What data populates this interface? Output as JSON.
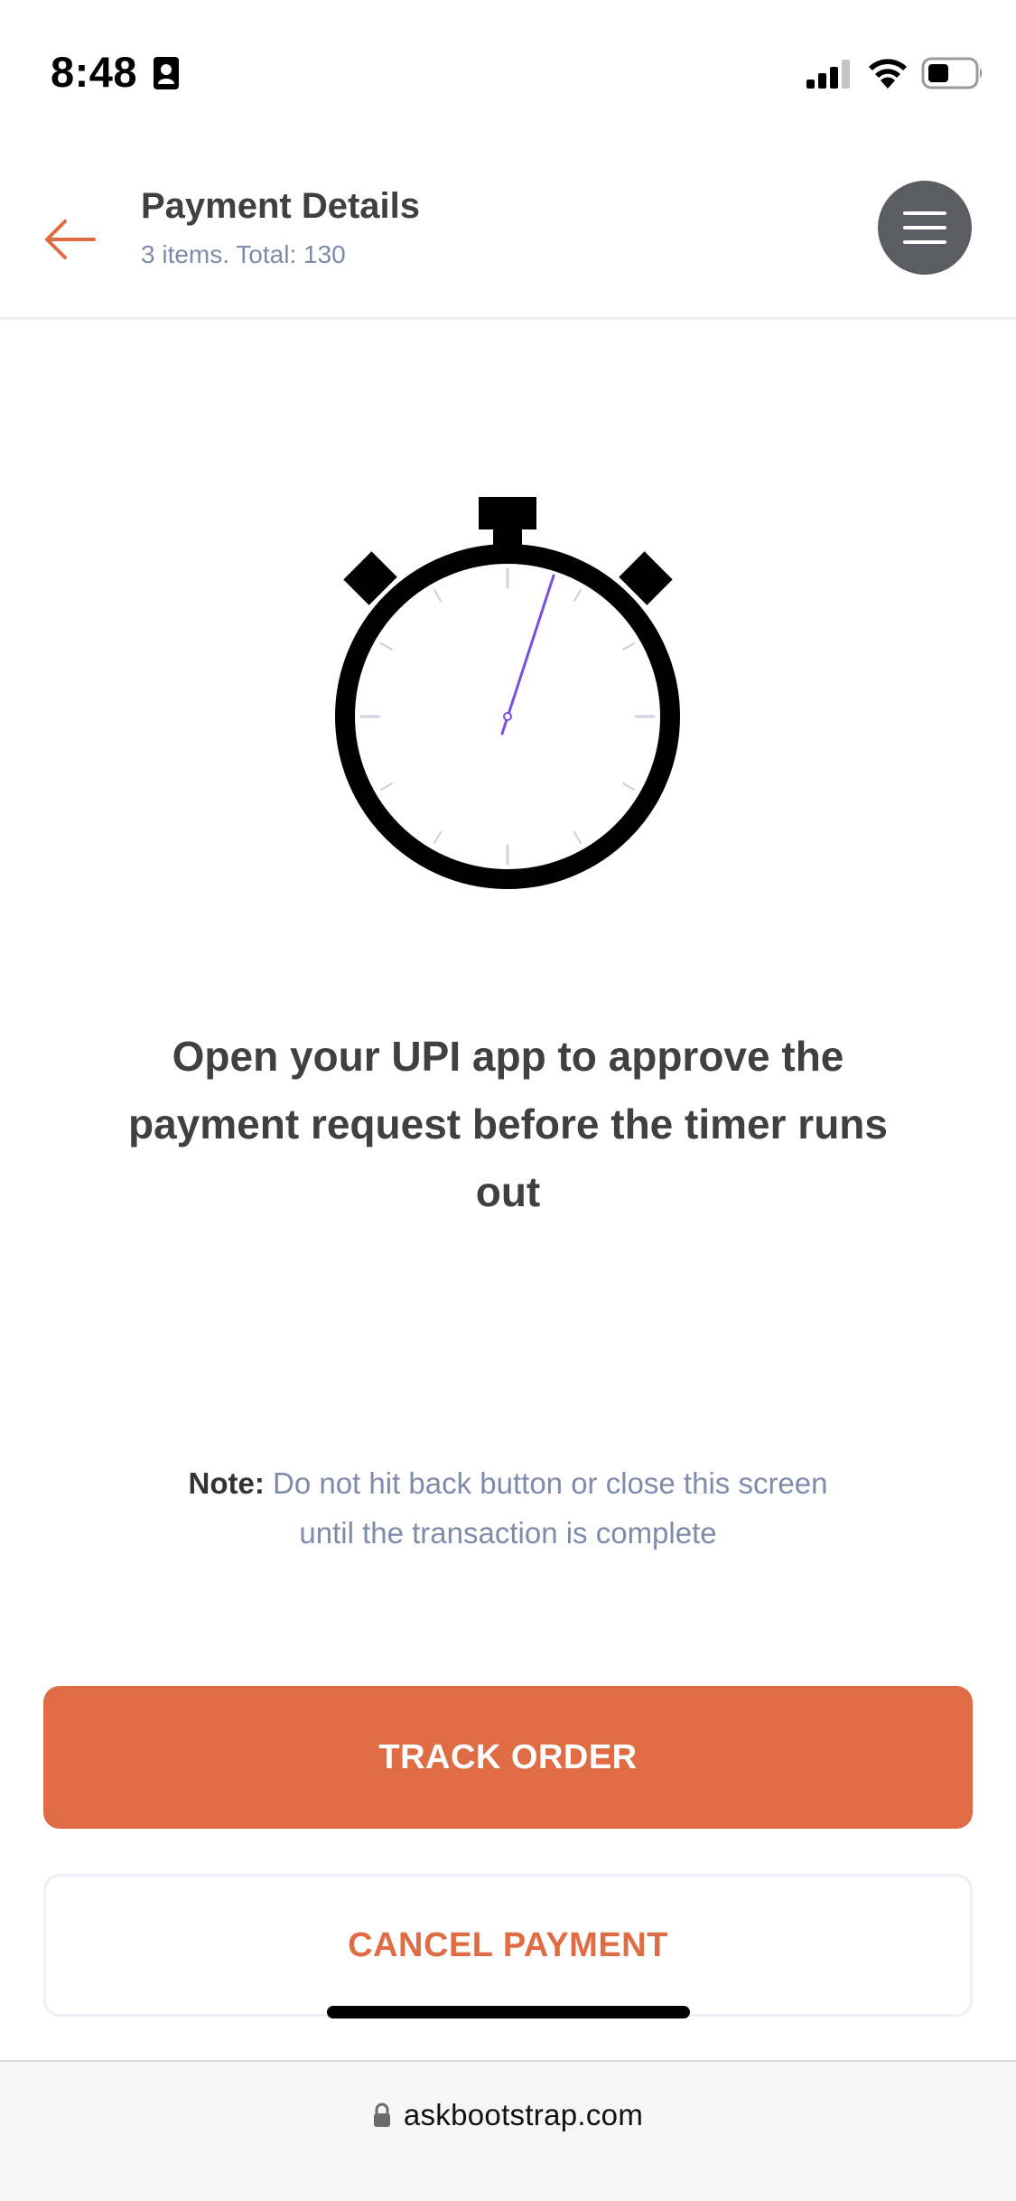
{
  "status_bar": {
    "time": "8:48",
    "icons": [
      "contact-card-icon",
      "cellular-signal-icon",
      "wifi-icon",
      "battery-icon"
    ]
  },
  "header": {
    "title": "Payment Details",
    "subtitle": "3 items. Total: 130",
    "back_icon": "arrow-left-icon",
    "menu_icon": "hamburger-menu-icon"
  },
  "main": {
    "illustration": "stopwatch-icon",
    "message": "Open your UPI app to approve the payment request before the timer runs out",
    "note_label": "Note:",
    "note_text": " Do not hit back button or close this screen until the transaction is complete"
  },
  "actions": {
    "track_order_label": "TRACK ORDER",
    "cancel_payment_label": "CANCEL PAYMENT"
  },
  "browser": {
    "url": "askbootstrap.com",
    "lock_icon": "lock-icon"
  },
  "colors": {
    "accent": "#df6c44",
    "text_dark": "#404040",
    "text_muted": "#7f8bab",
    "menu_button": "#5b5d62",
    "timer_hand": "#7b4de0"
  }
}
